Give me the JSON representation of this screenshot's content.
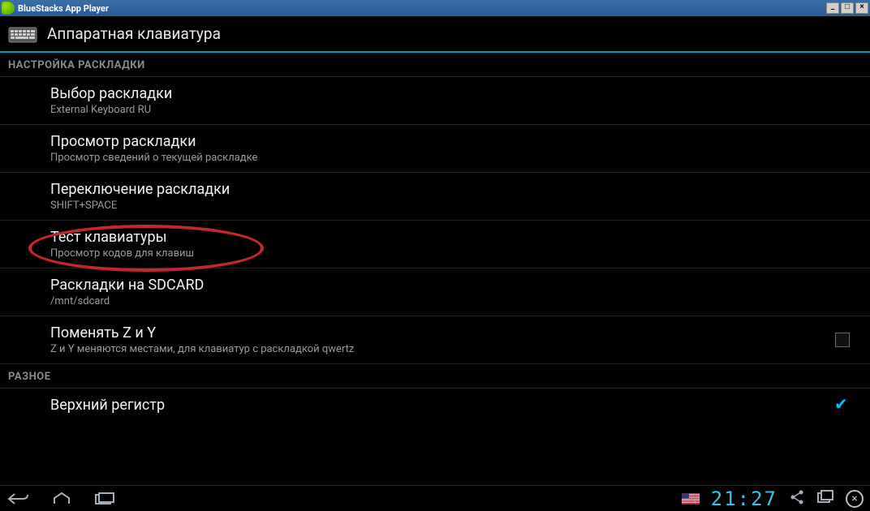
{
  "window": {
    "title": "BlueStacks App Player"
  },
  "header": {
    "title": "Аппаратная клавиатура"
  },
  "sections": {
    "layout": {
      "label": "НАСТРОЙКА РАСКЛАДКИ"
    },
    "misc": {
      "label": "РАЗНОЕ"
    }
  },
  "items": [
    {
      "title": "Выбор раскладки",
      "sub": "External Keyboard RU"
    },
    {
      "title": "Просмотр раскладки",
      "sub": "Просмотр сведений о текущей раскладке"
    },
    {
      "title": "Переключение раскладки",
      "sub": "SHIFT+SPACE"
    },
    {
      "title": "Тест клавиатуры",
      "sub": "Просмотр кодов для клавиш"
    },
    {
      "title": "Раскладки на SDCARD",
      "sub": "/mnt/sdcard"
    },
    {
      "title": "Поменять Z и Y",
      "sub": "Z и Y меняются местами, для клавиатур с раскладкой qwertz"
    },
    {
      "title": "Верхний регистр",
      "sub": ""
    }
  ],
  "status": {
    "time": "21:27"
  }
}
